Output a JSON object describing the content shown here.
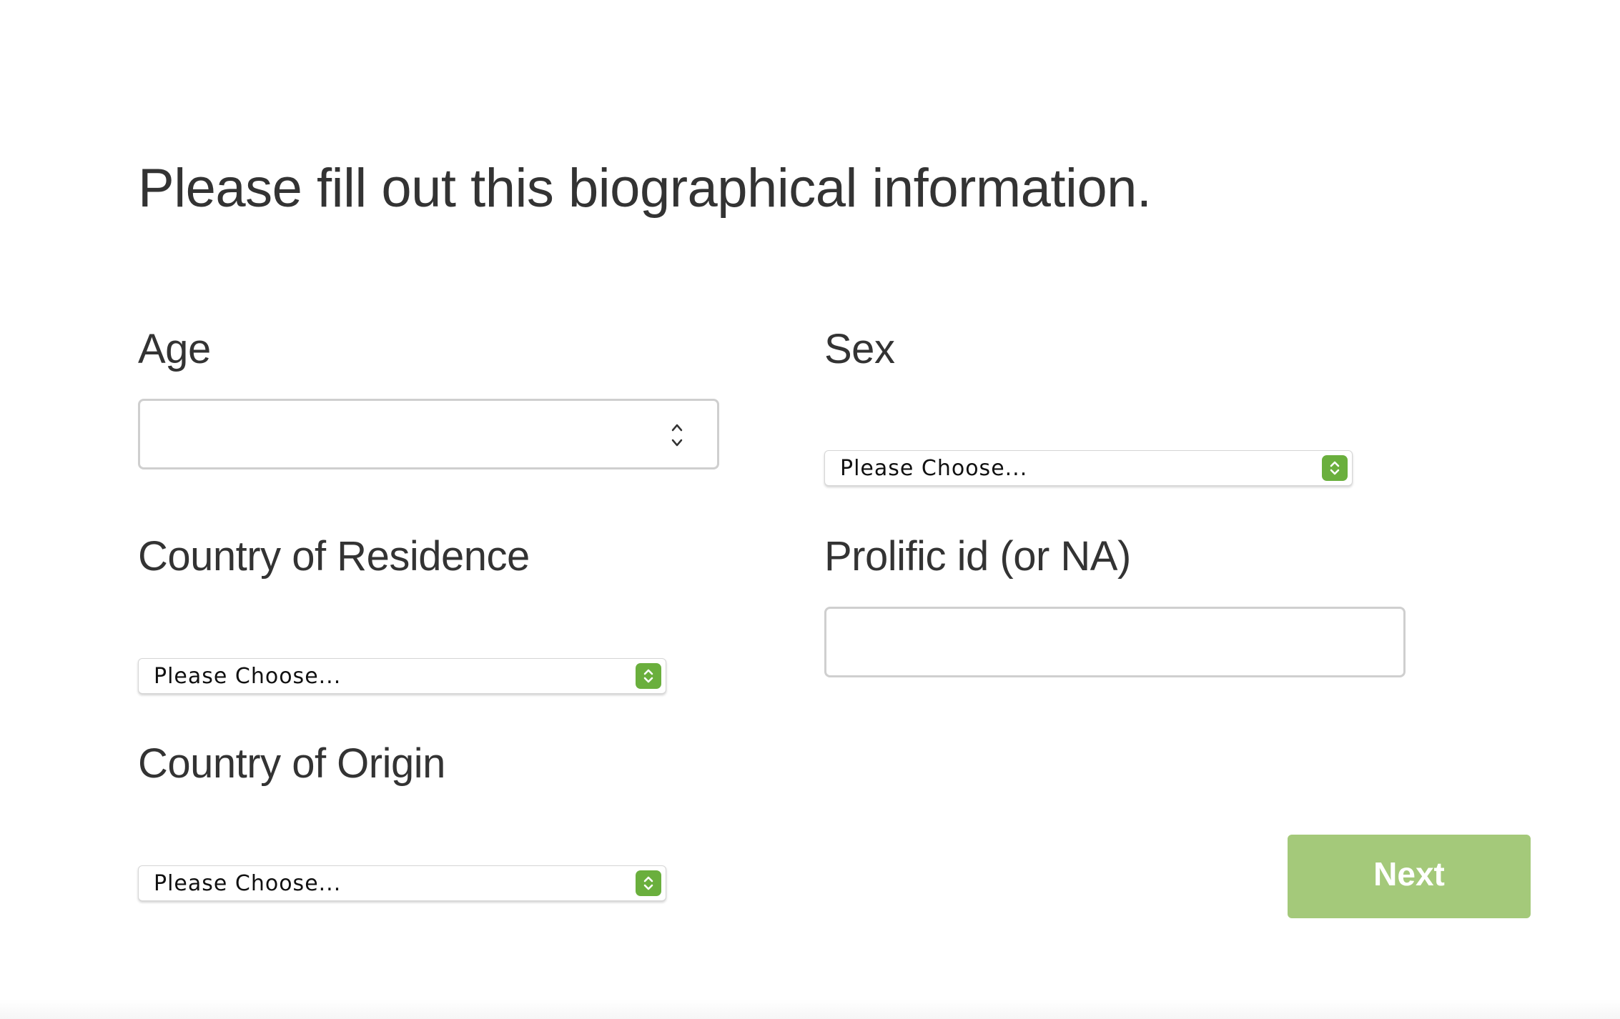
{
  "page": {
    "title": "Please fill out this biographical information."
  },
  "fields": {
    "age": {
      "label": "Age",
      "value": ""
    },
    "sex": {
      "label": "Sex",
      "selected": "Please Choose..."
    },
    "country_of_residence": {
      "label": "Country of Residence",
      "selected": "Please Choose..."
    },
    "prolific_id": {
      "label": "Prolific id (or NA)",
      "value": ""
    },
    "country_of_origin": {
      "label": "Country of Origin",
      "selected": "Please Choose..."
    }
  },
  "buttons": {
    "next_label": "Next"
  },
  "icons": {
    "select_arrow": "up-down-chevron-icon",
    "number_spinner": "spinner-up-down-icon"
  },
  "colors": {
    "text": "#333333",
    "accent_green": "#6aaf3d",
    "next_button": "#a4c97a"
  }
}
